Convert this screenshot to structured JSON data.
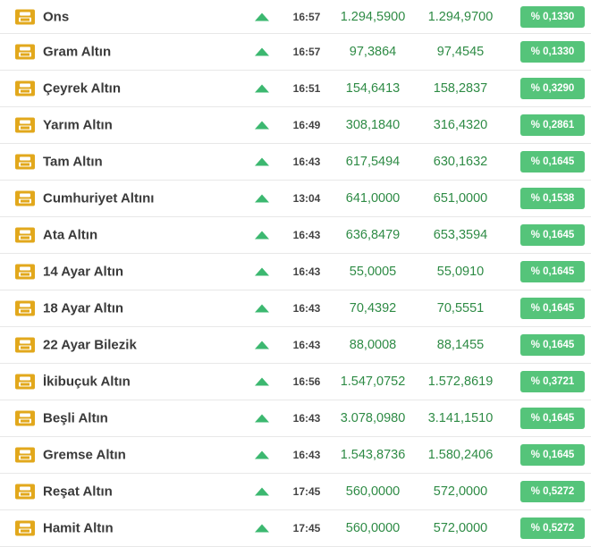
{
  "rows": [
    {
      "name": "Ons",
      "time": "16:57",
      "buy": "1.294,5900",
      "sell": "1.294,9700",
      "change": "% 0,1330"
    },
    {
      "name": "Gram Altın",
      "time": "16:57",
      "buy": "97,3864",
      "sell": "97,4545",
      "change": "% 0,1330"
    },
    {
      "name": "Çeyrek Altın",
      "time": "16:51",
      "buy": "154,6413",
      "sell": "158,2837",
      "change": "% 0,3290"
    },
    {
      "name": "Yarım Altın",
      "time": "16:49",
      "buy": "308,1840",
      "sell": "316,4320",
      "change": "% 0,2861"
    },
    {
      "name": "Tam Altın",
      "time": "16:43",
      "buy": "617,5494",
      "sell": "630,1632",
      "change": "% 0,1645"
    },
    {
      "name": "Cumhuriyet Altını",
      "time": "13:04",
      "buy": "641,0000",
      "sell": "651,0000",
      "change": "% 0,1538"
    },
    {
      "name": "Ata Altın",
      "time": "16:43",
      "buy": "636,8479",
      "sell": "653,3594",
      "change": "% 0,1645"
    },
    {
      "name": "14 Ayar Altın",
      "time": "16:43",
      "buy": "55,0005",
      "sell": "55,0910",
      "change": "% 0,1645"
    },
    {
      "name": "18 Ayar Altın",
      "time": "16:43",
      "buy": "70,4392",
      "sell": "70,5551",
      "change": "% 0,1645"
    },
    {
      "name": "22 Ayar Bilezik",
      "time": "16:43",
      "buy": "88,0008",
      "sell": "88,1455",
      "change": "% 0,1645"
    },
    {
      "name": "İkibuçuk Altın",
      "time": "16:56",
      "buy": "1.547,0752",
      "sell": "1.572,8619",
      "change": "% 0,3721"
    },
    {
      "name": "Beşli Altın",
      "time": "16:43",
      "buy": "3.078,0980",
      "sell": "3.141,1510",
      "change": "% 0,1645"
    },
    {
      "name": "Gremse Altın",
      "time": "16:43",
      "buy": "1.543,8736",
      "sell": "1.580,2406",
      "change": "% 0,1645"
    },
    {
      "name": "Reşat Altın",
      "time": "17:45",
      "buy": "560,0000",
      "sell": "572,0000",
      "change": "% 0,5272"
    },
    {
      "name": "Hamit Altın",
      "time": "17:45",
      "buy": "560,0000",
      "sell": "572,0000",
      "change": "% 0,5272"
    }
  ],
  "icons": {
    "row_icon": "gold-bars-icon",
    "trend_icon": "trend-up-icon"
  },
  "colors": {
    "icon": "#e2a81c",
    "trend_up": "#3cb870",
    "price": "#2e8b45",
    "change_badge": "#55c47a"
  }
}
